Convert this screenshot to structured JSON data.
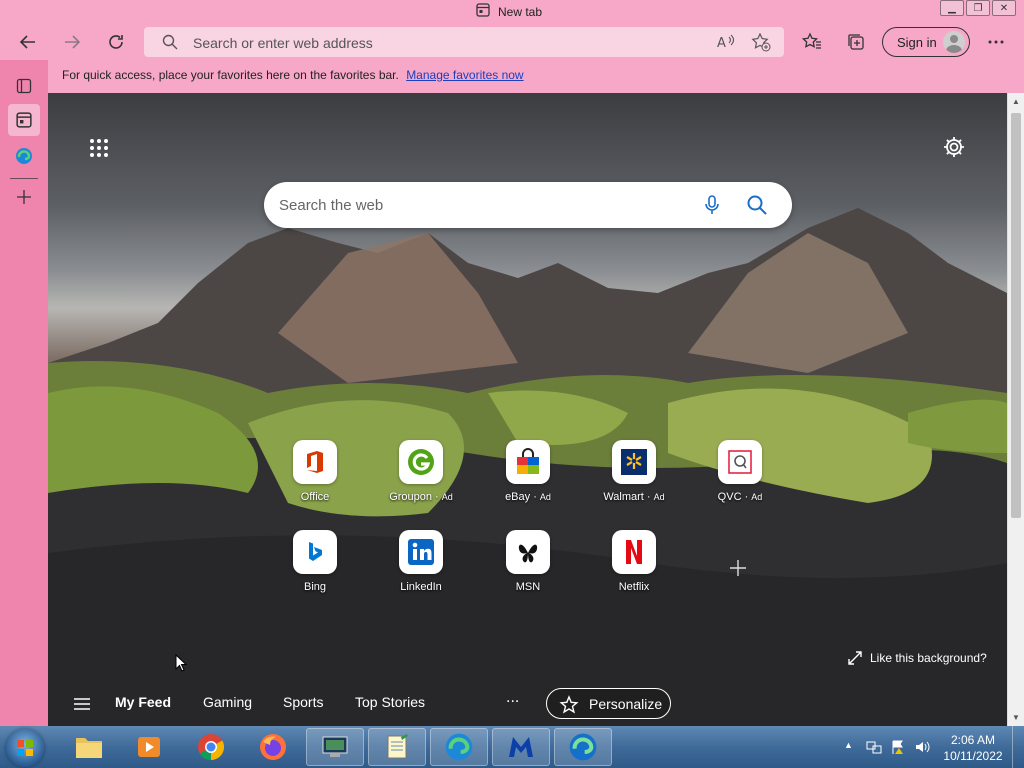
{
  "window": {
    "tab_title": "New tab"
  },
  "toolbar": {
    "address_placeholder": "Search or enter web address",
    "sign_in_label": "Sign in"
  },
  "favorites_bar": {
    "message": "For quick access, place your favorites here on the favorites bar.",
    "link": "Manage favorites now"
  },
  "newtab": {
    "search_placeholder": "Search the web",
    "tiles_row1": [
      {
        "label": "Office",
        "ad": "",
        "color": "#d83b01"
      },
      {
        "label": "Groupon",
        "ad": "Ad",
        "color": "#53a318"
      },
      {
        "label": "eBay",
        "ad": "Ad",
        "color": "#0064d2"
      },
      {
        "label": "Walmart",
        "ad": "Ad",
        "color": "#0071ce"
      },
      {
        "label": "QVC",
        "ad": "Ad",
        "color": "#e31837"
      }
    ],
    "tiles_row2": [
      {
        "label": "Bing",
        "color": "#0078d4"
      },
      {
        "label": "LinkedIn",
        "color": "#0a66c2"
      },
      {
        "label": "MSN",
        "color": "#000000"
      },
      {
        "label": "Netflix",
        "color": "#e50914"
      }
    ],
    "like_background": "Like this background?",
    "feed": {
      "items": [
        "My Feed",
        "Gaming",
        "Sports",
        "Top Stories"
      ],
      "more": "...",
      "personalize": "Personalize"
    }
  },
  "taskbar": {
    "time": "2:06 AM",
    "date": "10/11/2022"
  }
}
